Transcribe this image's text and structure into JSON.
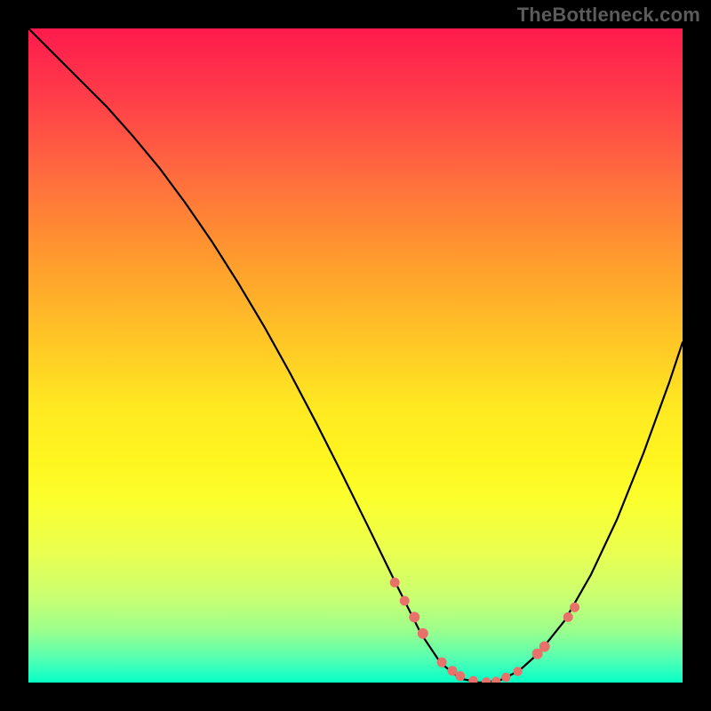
{
  "watermark": "TheBottleneck.com",
  "colors": {
    "frame_bg": "#000000",
    "gradient_top": "#ff1a4d",
    "gradient_bottom": "#06ffc2",
    "curve": "#000000",
    "dots": "#e8726b"
  },
  "chart_data": {
    "type": "line",
    "title": "",
    "xlabel": "",
    "ylabel": "",
    "xlim": [
      0,
      100
    ],
    "ylim": [
      0,
      100
    ],
    "series": [
      {
        "name": "curve",
        "x": [
          0,
          4,
          8,
          12,
          16,
          20,
          24,
          28,
          32,
          36,
          40,
          44,
          48,
          52,
          56,
          60,
          63,
          66,
          69,
          72,
          75,
          78,
          82,
          86,
          90,
          94,
          98,
          100
        ],
        "values": [
          100,
          96,
          92,
          88,
          83.5,
          78.7,
          73.3,
          67.5,
          61.2,
          54.5,
          47.3,
          39.7,
          31.8,
          23.7,
          15.5,
          7.5,
          3.0,
          0.6,
          0.0,
          0.3,
          1.8,
          4.5,
          9.5,
          16.5,
          25.0,
          35.0,
          46.0,
          52.0
        ]
      }
    ],
    "scatter_points": {
      "name": "dots",
      "x": [
        56.0,
        57.5,
        59.0,
        60.3,
        63.2,
        64.8,
        66.0,
        68.0,
        70.0,
        71.5,
        73.0,
        74.8,
        77.8,
        78.9,
        82.5,
        83.5
      ],
      "values": [
        15.3,
        12.5,
        10.0,
        7.5,
        3.1,
        1.8,
        1.0,
        0.3,
        0.1,
        0.2,
        0.8,
        1.7,
        4.4,
        5.5,
        10.0,
        11.5
      ],
      "radius": [
        5.5,
        5.5,
        6.0,
        6.0,
        5.5,
        5.5,
        5.5,
        5.2,
        5.2,
        5.2,
        5.2,
        5.2,
        6.0,
        6.0,
        5.5,
        5.5
      ]
    }
  }
}
